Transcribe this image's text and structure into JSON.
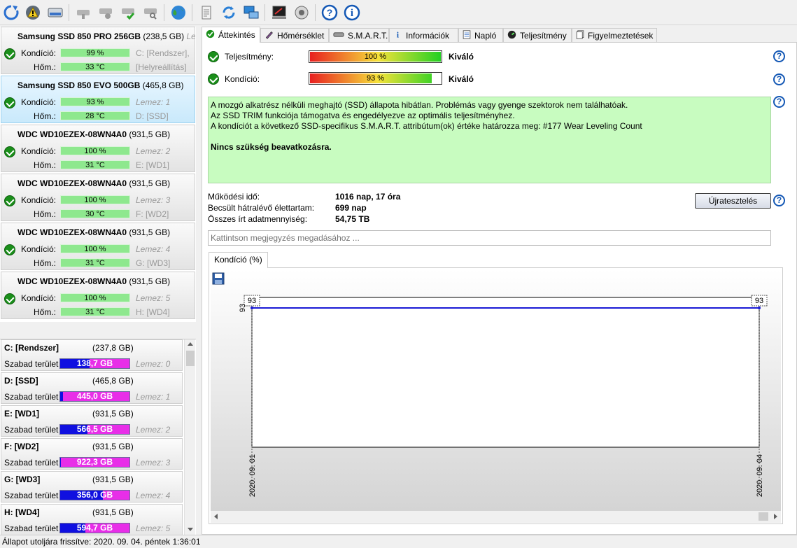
{
  "toolbar": {
    "buttons": [
      {
        "name": "refresh",
        "icon": "refresh-icon"
      },
      {
        "name": "alert",
        "icon": "warning-icon"
      },
      {
        "name": "drive",
        "icon": "drive-icon"
      },
      {
        "name": "disk-tool-1",
        "icon": "disk-tool-icon"
      },
      {
        "name": "disk-tool-2",
        "icon": "disk-gear-icon"
      },
      {
        "name": "disk-tool-3",
        "icon": "disk-check-icon"
      },
      {
        "name": "disk-tool-4",
        "icon": "disk-magnifier-icon"
      },
      {
        "name": "globe",
        "icon": "globe-icon"
      },
      {
        "name": "report",
        "icon": "report-icon"
      },
      {
        "name": "sync",
        "icon": "sync-icon"
      },
      {
        "name": "network",
        "icon": "network-icon"
      },
      {
        "name": "console",
        "icon": "console-icon"
      },
      {
        "name": "sound",
        "icon": "speaker-icon"
      },
      {
        "name": "help",
        "icon": "help-icon"
      },
      {
        "name": "info",
        "icon": "info-icon"
      }
    ]
  },
  "disks": [
    {
      "name": "Samsung SSD 850 PRO 256GB",
      "size": "(238,5 GB)",
      "size_extra": "Leme",
      "health_label": "Kondíció:",
      "health": "99 %",
      "temp_label": "Hőm.:",
      "temp": "33 °C",
      "aux1": "C: [Rendszer],",
      "aux2": "[Helyreállítás]",
      "selected": false
    },
    {
      "name": "Samsung SSD 850 EVO 500GB",
      "size": "(465,8 GB)",
      "size_extra": "",
      "health_label": "Kondíció:",
      "health": "93 %",
      "temp_label": "Hőm.:",
      "temp": "28 °C",
      "aux1": "Lemez: 1",
      "aux2": "D: [SSD]",
      "selected": true
    },
    {
      "name": "WDC WD10EZEX-08WN4A0",
      "size": "(931,5 GB)",
      "size_extra": "",
      "health_label": "Kondíció:",
      "health": "100 %",
      "temp_label": "Hőm.:",
      "temp": "31 °C",
      "aux1": "Lemez: 2",
      "aux2": "E: [WD1]",
      "selected": false
    },
    {
      "name": "WDC WD10EZEX-08WN4A0",
      "size": "(931,5 GB)",
      "size_extra": "",
      "health_label": "Kondíció:",
      "health": "100 %",
      "temp_label": "Hőm.:",
      "temp": "30 °C",
      "aux1": "Lemez: 3",
      "aux2": "F: [WD2]",
      "selected": false
    },
    {
      "name": "WDC WD10EZEX-08WN4A0",
      "size": "(931,5 GB)",
      "size_extra": "",
      "health_label": "Kondíció:",
      "health": "100 %",
      "temp_label": "Hőm.:",
      "temp": "31 °C",
      "aux1": "Lemez: 4",
      "aux2": "G: [WD3]",
      "selected": false
    },
    {
      "name": "WDC WD10EZEX-08WN4A0",
      "size": "(931,5 GB)",
      "size_extra": "",
      "health_label": "Kondíció:",
      "health": "100 %",
      "temp_label": "Hőm.:",
      "temp": "31 °C",
      "aux1": "Lemez: 5",
      "aux2": "H: [WD4]",
      "selected": false
    }
  ],
  "partitions": [
    {
      "name": "C: [Rendszer]",
      "size": "(237,8 GB)",
      "free_label": "Szabad terület",
      "free": "138,7 GB",
      "used_fraction": 0.42,
      "disk": "Lemez: 0"
    },
    {
      "name": "D: [SSD]",
      "size": "(465,8 GB)",
      "free_label": "Szabad terület",
      "free": "445,0 GB",
      "used_fraction": 0.04,
      "disk": "Lemez: 1"
    },
    {
      "name": "E: [WD1]",
      "size": "(931,5 GB)",
      "free_label": "Szabad terület",
      "free": "566,5 GB",
      "used_fraction": 0.39,
      "disk": "Lemez: 2"
    },
    {
      "name": "F: [WD2]",
      "size": "(931,5 GB)",
      "free_label": "Szabad terület",
      "free": "922,3 GB",
      "used_fraction": 0.01,
      "disk": "Lemez: 3"
    },
    {
      "name": "G: [WD3]",
      "size": "(931,5 GB)",
      "free_label": "Szabad terület",
      "free": "356,0 GB",
      "used_fraction": 0.62,
      "disk": "Lemez: 4"
    },
    {
      "name": "H: [WD4]",
      "size": "(931,5 GB)",
      "free_label": "Szabad terület",
      "free": "594,7 GB",
      "used_fraction": 0.36,
      "disk": "Lemez: 5"
    }
  ],
  "tabs": [
    {
      "label": "Áttekintés",
      "icon": "overview-check-icon",
      "active": true
    },
    {
      "label": "Hőmérséklet",
      "icon": "thermometer-icon",
      "active": false
    },
    {
      "label": "S.M.A.R.T.",
      "icon": "smart-disk-icon",
      "active": false
    },
    {
      "label": "Információk",
      "icon": "info-icon",
      "active": false
    },
    {
      "label": "Napló",
      "icon": "log-icon",
      "active": false
    },
    {
      "label": "Teljesítmény",
      "icon": "gauge-icon",
      "active": false
    },
    {
      "label": "Figyelmeztetések",
      "icon": "alerts-icon",
      "active": false
    }
  ],
  "overview": {
    "performance_label": "Teljesítmény:",
    "performance_value": "100 %",
    "performance_fraction": 1.0,
    "performance_rating": "Kiváló",
    "health_label": "Kondíció:",
    "health_value": "93 %",
    "health_fraction": 0.93,
    "health_rating": "Kiváló",
    "description": [
      "A mozgó alkatrész nélküli meghajtó (SSD) állapota hibátlan. Problémás vagy gyenge szektorok nem találhatóak.",
      "Az SSD TRIM funkciója támogatva és engedélyezve az optimális teljesítményhez.",
      "A kondíciót a következő SSD-specifikus S.M.A.R.T. attribútum(ok) értéke határozza meg:  #177 Wear Leveling Count"
    ],
    "recommendation": "Nincs szükség beavatkozásra.",
    "uptime_label": "Működési idő:",
    "uptime_value": "1016 nap, 17 óra",
    "lifetime_label": "Becsült hátralévő élettartam:",
    "lifetime_value": "699 nap",
    "written_label": "Összes írt adatmennyiség:",
    "written_value": "54,75 TB",
    "retest_label": "Újratesztelés",
    "note_placeholder": "Kattintson megjegyzés megadásához ...",
    "chart_tab_label": "Kondíció  (%)"
  },
  "chart_data": {
    "type": "line",
    "x": [
      "2020. 09. 01",
      "2020. 09. 04"
    ],
    "series": [
      {
        "values": [
          93,
          93
        ],
        "color": "#1a1ad6"
      }
    ],
    "ylabel": "93",
    "data_labels": [
      "93",
      "93"
    ],
    "grid": false
  },
  "statusbar": {
    "text": "Állapot utoljára frissítve: 2020. 09. 04. péntek 1:36:01"
  }
}
